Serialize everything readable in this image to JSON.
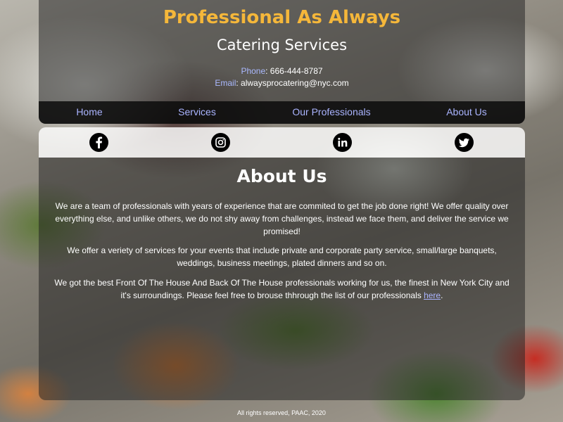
{
  "header": {
    "title": "Professional As Always",
    "subtitle": "Catering Services",
    "phone_label": "Phone",
    "phone_value": ": 666-444-8787",
    "email_label": "Email",
    "email_value": ": alwaysprocatering@nyc.com",
    "title_color": "#f5b73a",
    "label_color": "#aab9ff"
  },
  "nav": {
    "items": [
      {
        "label": "Home"
      },
      {
        "label": "Services"
      },
      {
        "label": "Our Professionals"
      },
      {
        "label": "About Us"
      }
    ]
  },
  "social": {
    "icons": [
      "facebook-icon",
      "instagram-icon",
      "linkedin-icon",
      "twitter-icon"
    ]
  },
  "about": {
    "title": "About Us",
    "p1": "We are a team of professionals with years of experience that are commited to get the job done right! We offer quality over everything else, and unlike others, we do not shy away from challenges, instead we face them, and deliver the service we promised!",
    "p2": "We offer a veriety of services for your events that include private and corporate party service, small/large banquets, weddings, business meetings, plated dinners and so on.",
    "p3_text": "We got the best Front Of The House And Back Of The House professionals working for us, the finest in New York City and it's surroundings. Please feel free to brouse thhrough the list of our professionals ",
    "p3_link": "here",
    "p3_end": "."
  },
  "footer": {
    "text": "All rights reserved, PAAC, 2020"
  }
}
